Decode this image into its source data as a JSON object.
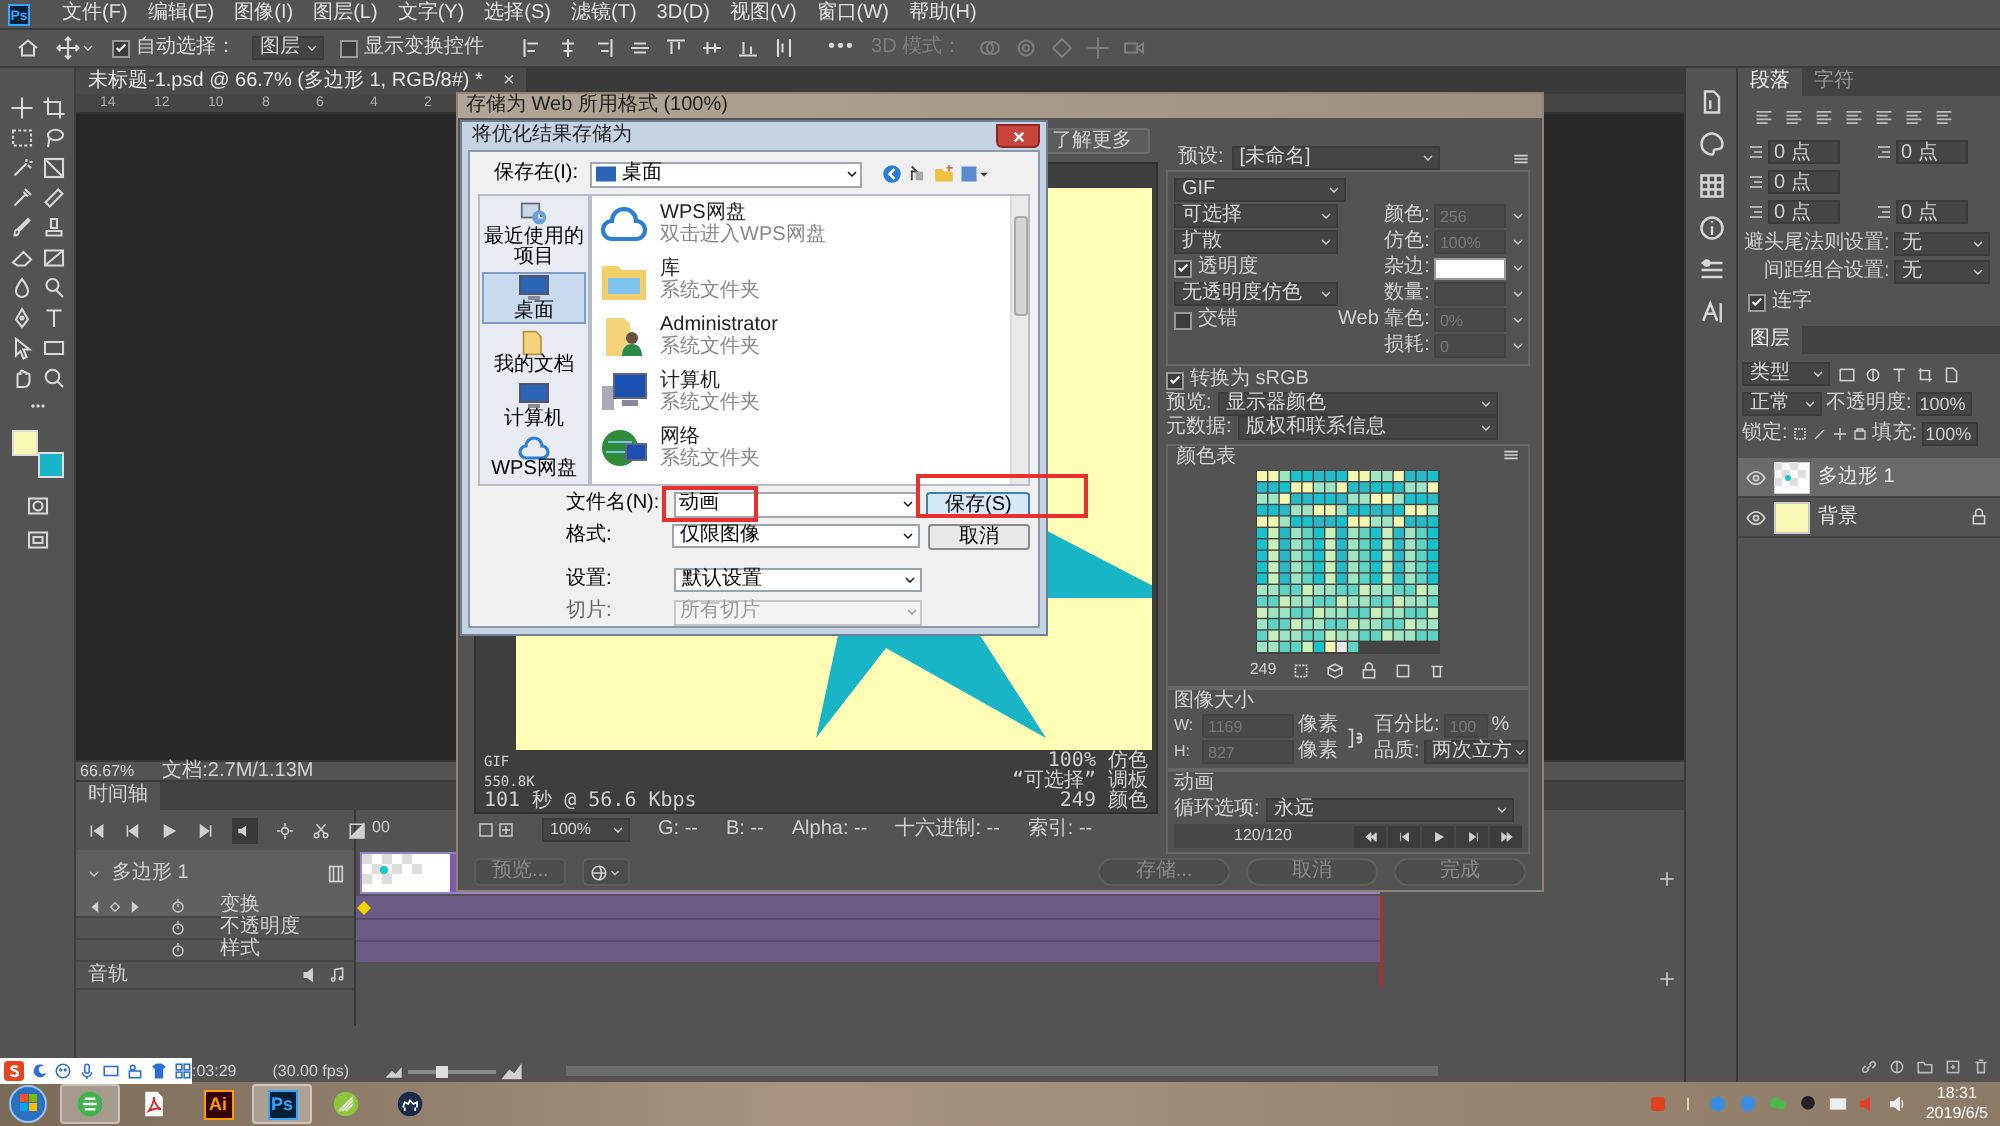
{
  "menu_bar": {
    "logo": "Ps",
    "items": [
      "文件(F)",
      "编辑(E)",
      "图像(I)",
      "图层(L)",
      "文字(Y)",
      "选择(S)",
      "滤镜(T)",
      "3D(D)",
      "视图(V)",
      "窗口(W)",
      "帮助(H)"
    ]
  },
  "options_bar": {
    "auto_select": {
      "label": "自动选择：",
      "checked": true
    },
    "target": "图层",
    "show_transform": {
      "label": "显示变换控件",
      "checked": false
    },
    "more": "•••",
    "mode_3d": "3D 模式："
  },
  "document_tab": {
    "title": "未标题-1.psd @ 66.7% (多边形 1, RGB/8#) *",
    "close": "×"
  },
  "ruler": [
    "14",
    "12",
    "10",
    "8",
    "6",
    "4",
    "2"
  ],
  "status_bar": {
    "zoom": "66.67%",
    "document": "文档:2.7M/1.13M"
  },
  "timeline": {
    "tab": "时间轴",
    "ruler": [
      "00"
    ],
    "zoom_slider": {
      "level": 0.4
    },
    "layer": {
      "name": "多边形 1",
      "expanded": true
    },
    "properties": [
      {
        "label": "变换",
        "selected": true,
        "keyframes": true
      },
      {
        "label": "不透明度",
        "selected": false,
        "keyframes": false
      },
      {
        "label": "样式",
        "selected": false,
        "keyframes": false
      }
    ],
    "audio": "音轨",
    "time": ":03:29",
    "fps": "(30.00 fps)"
  },
  "right_panel": {
    "tabs": [
      {
        "label": "段落",
        "selected": true
      },
      {
        "label": "字符",
        "selected": false
      }
    ],
    "indents": [
      "0 点",
      "0 点",
      "0 点",
      "0 点",
      "0 点"
    ],
    "kinsoku_label": "避头尾法则设置:",
    "kinsoku": "无",
    "mojikumi_label": "间距组合设置:",
    "mojikumi": "无",
    "hyphenate": {
      "label": "连字",
      "checked": true
    },
    "layers_tab": "图层",
    "filter": "类型",
    "blend": "正常",
    "opacity_label": "不透明度:",
    "opacity": "100%",
    "lock_label": "锁定:",
    "fill_label": "填充:",
    "fill": "100%",
    "layers": [
      {
        "name": "多边形 1",
        "selected": true,
        "locked": false,
        "kind": "shape"
      },
      {
        "name": "背景",
        "selected": false,
        "locked": true,
        "kind": "fill"
      }
    ]
  },
  "save_for_web": {
    "title": "存储为 Web 所用格式 (100%)",
    "learn_more": "了解更多",
    "info_left": [
      "GIF",
      "550.8K",
      "101 秒 @ 56.6 Kbps"
    ],
    "info_right": [
      "100% 仿色",
      "“可选择” 调板",
      "249 颜色"
    ],
    "zoom": "100%",
    "readouts": [
      "G: --",
      "B: --",
      "Alpha: --",
      "十六进制: --",
      "索引: --"
    ],
    "preview_button": "预览...",
    "buttons": [
      "存储...",
      "取消",
      "完成"
    ],
    "settings": {
      "preset_label": "预设:",
      "preset": "[未命名]",
      "format": "GIF",
      "reduction": "可选择",
      "dither_algorithm": "扩散",
      "transparency": {
        "label": "透明度",
        "checked": true
      },
      "transparency_dither": "无透明度仿色",
      "interlaced": {
        "label": "交错",
        "checked": false
      },
      "fields": [
        {
          "label": "颜色:",
          "value": "256",
          "kind": "field",
          "disabled": true
        },
        {
          "label": "仿色:",
          "value": "100%",
          "kind": "field",
          "disabled": true
        },
        {
          "label": "杂边:",
          "kind": "swatch",
          "disabled": false
        },
        {
          "label": "数量:",
          "kind": "field",
          "disabled": true
        },
        {
          "label": "Web 靠色:",
          "value": "0%",
          "kind": "field",
          "disabled": true
        },
        {
          "label": "损耗:",
          "value": "0",
          "kind": "field",
          "disabled": true
        }
      ],
      "srgb": {
        "label": "转换为 sRGB",
        "checked": true
      },
      "preview_label": "预览:",
      "preview": "显示器颜色",
      "metadata_label": "元数据:",
      "metadata": "版权和联系信息"
    },
    "color_table": {
      "title": "颜色表",
      "count": "249"
    },
    "image_size": {
      "title": "图像大小",
      "rows": [
        {
          "label": "W:",
          "value": "1169",
          "unit": "像素"
        },
        {
          "label": "H:",
          "value": "827",
          "unit": "像素"
        }
      ],
      "percent_label": "百分比:",
      "percent": "100",
      "percent_unit": "%",
      "quality_label": "品质:",
      "quality": "两次立方"
    },
    "animation": {
      "title": "动画",
      "loop_label": "循环选项:",
      "loop": "永远",
      "frame": "120/120"
    }
  },
  "save_as": {
    "title": "将优化结果存储为",
    "location_label": "保存在(I):",
    "location": "桌面",
    "places": [
      {
        "label": "最近使用的项目",
        "kind": "recent",
        "selected": false
      },
      {
        "label": "桌面",
        "kind": "desktop",
        "selected": true
      },
      {
        "label": "我的文档",
        "kind": "documents",
        "selected": false
      },
      {
        "label": "计算机",
        "kind": "computer",
        "selected": false
      },
      {
        "label": "WPS网盘",
        "kind": "cloud",
        "selected": false
      }
    ],
    "files": [
      {
        "name": "WPS网盘",
        "detail": "双击进入WPS网盘",
        "kind": "cloud"
      },
      {
        "name": "库",
        "detail": "系统文件夹",
        "kind": "library"
      },
      {
        "name": "Administrator",
        "detail": "系统文件夹",
        "kind": "user"
      },
      {
        "name": "计算机",
        "detail": "系统文件夹",
        "kind": "computer"
      },
      {
        "name": "网络",
        "detail": "系统文件夹",
        "kind": "network"
      }
    ],
    "filename_label": "文件名(N):",
    "filename": "动画",
    "format_label": "格式:",
    "format": "仅限图像",
    "save": "保存(S)",
    "cancel": "取消",
    "settings_label": "设置:",
    "settings": "默认设置",
    "slices_label": "切片:",
    "slices": "所有切片",
    "slices_disabled": true,
    "filename_highlighted": true,
    "save_highlighted": true
  },
  "taskbar": {
    "apps": [
      {
        "kind": "browser",
        "active": true
      },
      {
        "kind": "pdf",
        "active": false
      },
      {
        "kind": "illustrator",
        "label": "Ai",
        "active": false
      },
      {
        "kind": "photoshop",
        "label": "Ps",
        "active": true
      },
      {
        "kind": "leaf",
        "active": false
      },
      {
        "kind": "camel",
        "active": false
      }
    ],
    "time": "18:31",
    "date": "2019/6/5"
  }
}
